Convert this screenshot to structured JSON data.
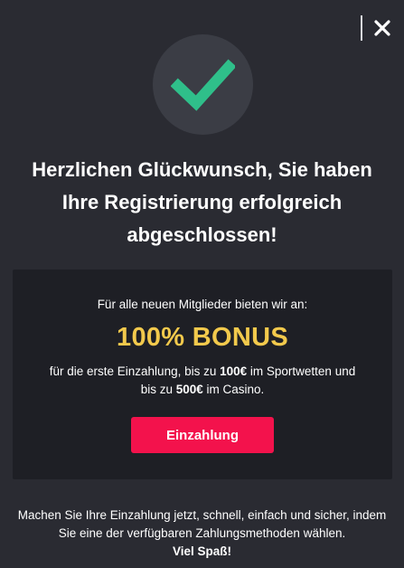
{
  "modal": {
    "close_icon": "close-icon",
    "success_icon": "checkmark-icon",
    "headline": {
      "line1": "Herzlichen Glückwunsch, Sie haben",
      "line2": "Ihre Registrierung erfolgreich",
      "line3": "abgeschlossen!"
    }
  },
  "bonus": {
    "intro": "Für alle neuen Mitglieder bieten wir an:",
    "title": "100% BONUS",
    "desc_line1_pre": "für die erste Einzahlung, bis zu ",
    "desc_amount_sport": "100€",
    "desc_line1_post": " im Sportwetten und",
    "desc_line2_pre": "bis zu ",
    "desc_amount_casino": "500€",
    "desc_line2_post": " im Casino.",
    "button_label": "Einzahlung"
  },
  "footer": {
    "line1": "Machen Sie Ihre Einzahlung jetzt, schnell, einfach und sicher, indem",
    "line2": "Sie eine der verfügbaren Zahlungsmethoden wählen.",
    "line3": "Viel Spaß!"
  },
  "colors": {
    "background": "#2a2b32",
    "card": "#1e1f25",
    "accent_button": "#f3124c",
    "bonus_title": "#f2c94c",
    "check_green": "#2fbf8a",
    "check_circle": "#3b3d45"
  }
}
